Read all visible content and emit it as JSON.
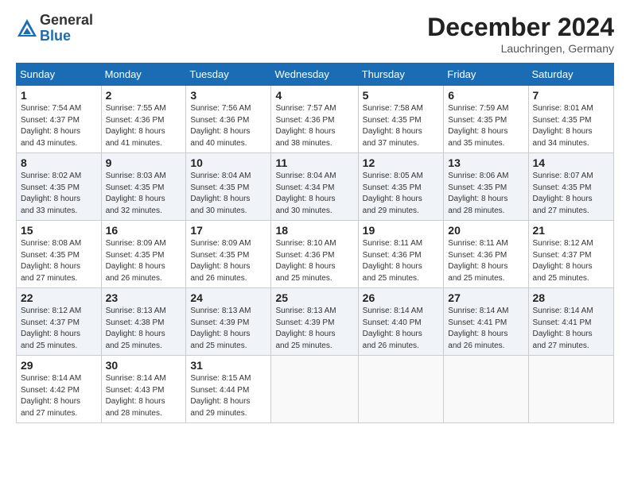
{
  "logo": {
    "general": "General",
    "blue": "Blue"
  },
  "header": {
    "month": "December 2024",
    "location": "Lauchringen, Germany"
  },
  "weekdays": [
    "Sunday",
    "Monday",
    "Tuesday",
    "Wednesday",
    "Thursday",
    "Friday",
    "Saturday"
  ],
  "weeks": [
    [
      {
        "day": "1",
        "info": "Sunrise: 7:54 AM\nSunset: 4:37 PM\nDaylight: 8 hours\nand 43 minutes."
      },
      {
        "day": "2",
        "info": "Sunrise: 7:55 AM\nSunset: 4:36 PM\nDaylight: 8 hours\nand 41 minutes."
      },
      {
        "day": "3",
        "info": "Sunrise: 7:56 AM\nSunset: 4:36 PM\nDaylight: 8 hours\nand 40 minutes."
      },
      {
        "day": "4",
        "info": "Sunrise: 7:57 AM\nSunset: 4:36 PM\nDaylight: 8 hours\nand 38 minutes."
      },
      {
        "day": "5",
        "info": "Sunrise: 7:58 AM\nSunset: 4:35 PM\nDaylight: 8 hours\nand 37 minutes."
      },
      {
        "day": "6",
        "info": "Sunrise: 7:59 AM\nSunset: 4:35 PM\nDaylight: 8 hours\nand 35 minutes."
      },
      {
        "day": "7",
        "info": "Sunrise: 8:01 AM\nSunset: 4:35 PM\nDaylight: 8 hours\nand 34 minutes."
      }
    ],
    [
      {
        "day": "8",
        "info": "Sunrise: 8:02 AM\nSunset: 4:35 PM\nDaylight: 8 hours\nand 33 minutes."
      },
      {
        "day": "9",
        "info": "Sunrise: 8:03 AM\nSunset: 4:35 PM\nDaylight: 8 hours\nand 32 minutes."
      },
      {
        "day": "10",
        "info": "Sunrise: 8:04 AM\nSunset: 4:35 PM\nDaylight: 8 hours\nand 30 minutes."
      },
      {
        "day": "11",
        "info": "Sunrise: 8:04 AM\nSunset: 4:34 PM\nDaylight: 8 hours\nand 30 minutes."
      },
      {
        "day": "12",
        "info": "Sunrise: 8:05 AM\nSunset: 4:35 PM\nDaylight: 8 hours\nand 29 minutes."
      },
      {
        "day": "13",
        "info": "Sunrise: 8:06 AM\nSunset: 4:35 PM\nDaylight: 8 hours\nand 28 minutes."
      },
      {
        "day": "14",
        "info": "Sunrise: 8:07 AM\nSunset: 4:35 PM\nDaylight: 8 hours\nand 27 minutes."
      }
    ],
    [
      {
        "day": "15",
        "info": "Sunrise: 8:08 AM\nSunset: 4:35 PM\nDaylight: 8 hours\nand 27 minutes."
      },
      {
        "day": "16",
        "info": "Sunrise: 8:09 AM\nSunset: 4:35 PM\nDaylight: 8 hours\nand 26 minutes."
      },
      {
        "day": "17",
        "info": "Sunrise: 8:09 AM\nSunset: 4:35 PM\nDaylight: 8 hours\nand 26 minutes."
      },
      {
        "day": "18",
        "info": "Sunrise: 8:10 AM\nSunset: 4:36 PM\nDaylight: 8 hours\nand 25 minutes."
      },
      {
        "day": "19",
        "info": "Sunrise: 8:11 AM\nSunset: 4:36 PM\nDaylight: 8 hours\nand 25 minutes."
      },
      {
        "day": "20",
        "info": "Sunrise: 8:11 AM\nSunset: 4:36 PM\nDaylight: 8 hours\nand 25 minutes."
      },
      {
        "day": "21",
        "info": "Sunrise: 8:12 AM\nSunset: 4:37 PM\nDaylight: 8 hours\nand 25 minutes."
      }
    ],
    [
      {
        "day": "22",
        "info": "Sunrise: 8:12 AM\nSunset: 4:37 PM\nDaylight: 8 hours\nand 25 minutes."
      },
      {
        "day": "23",
        "info": "Sunrise: 8:13 AM\nSunset: 4:38 PM\nDaylight: 8 hours\nand 25 minutes."
      },
      {
        "day": "24",
        "info": "Sunrise: 8:13 AM\nSunset: 4:39 PM\nDaylight: 8 hours\nand 25 minutes."
      },
      {
        "day": "25",
        "info": "Sunrise: 8:13 AM\nSunset: 4:39 PM\nDaylight: 8 hours\nand 25 minutes."
      },
      {
        "day": "26",
        "info": "Sunrise: 8:14 AM\nSunset: 4:40 PM\nDaylight: 8 hours\nand 26 minutes."
      },
      {
        "day": "27",
        "info": "Sunrise: 8:14 AM\nSunset: 4:41 PM\nDaylight: 8 hours\nand 26 minutes."
      },
      {
        "day": "28",
        "info": "Sunrise: 8:14 AM\nSunset: 4:41 PM\nDaylight: 8 hours\nand 27 minutes."
      }
    ],
    [
      {
        "day": "29",
        "info": "Sunrise: 8:14 AM\nSunset: 4:42 PM\nDaylight: 8 hours\nand 27 minutes."
      },
      {
        "day": "30",
        "info": "Sunrise: 8:14 AM\nSunset: 4:43 PM\nDaylight: 8 hours\nand 28 minutes."
      },
      {
        "day": "31",
        "info": "Sunrise: 8:15 AM\nSunset: 4:44 PM\nDaylight: 8 hours\nand 29 minutes."
      },
      {
        "day": "",
        "info": ""
      },
      {
        "day": "",
        "info": ""
      },
      {
        "day": "",
        "info": ""
      },
      {
        "day": "",
        "info": ""
      }
    ]
  ]
}
